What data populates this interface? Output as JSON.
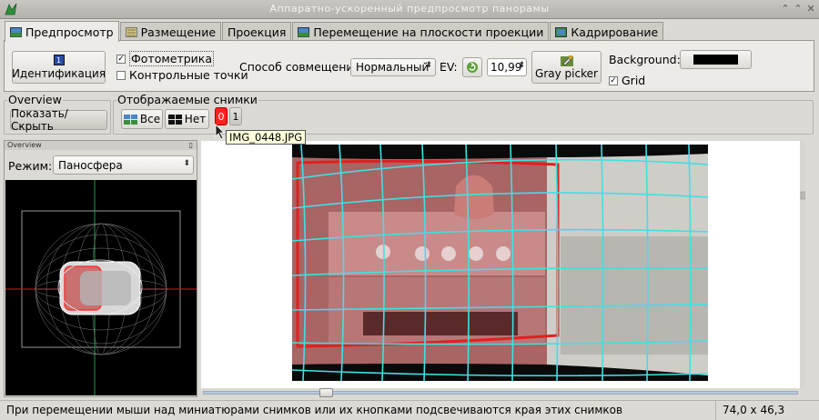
{
  "window": {
    "title": "Аппаратно-ускоренный предпросмотр панорамы",
    "buttons": [
      "⌃",
      "⌃",
      "✕"
    ]
  },
  "tabs": [
    {
      "label": "Предпросмотр",
      "active": true,
      "icon": "preview-icon"
    },
    {
      "label": "Размещение",
      "active": false,
      "icon": "layout-icon"
    },
    {
      "label": "Проекция",
      "active": false,
      "icon": ""
    },
    {
      "label": "Перемещение на плоскости проекции",
      "active": false,
      "icon": "move-icon"
    },
    {
      "label": "Кадрирование",
      "active": false,
      "icon": "crop-icon"
    }
  ],
  "toolbar": {
    "identify_label": "Идентификация",
    "identify_icon_text": "1",
    "photometry_label": "Фотометрика",
    "photometry_checked": true,
    "control_points_label": "Контрольные точки",
    "control_points_checked": false,
    "blend_label": "Способ совмещения:",
    "blend_value": "Нормальный",
    "ev_label": "EV:",
    "ev_value": "10,99",
    "gray_picker_label": "Gray picker",
    "background_label": "Background:",
    "background_color": "#000000",
    "grid_label": "Grid",
    "grid_checked": true
  },
  "overview_group": {
    "title": "Overview",
    "toggle_label": "Показать/Скрыть"
  },
  "images_group": {
    "title": "Отображаемые снимки",
    "all_label": "Все",
    "none_label": "Нет",
    "image_buttons": [
      "0",
      "1"
    ],
    "tooltip": "IMG_0448.JPG"
  },
  "overview_panel": {
    "header": "Overview",
    "mode_label": "Режим:",
    "mode_value": "Паносфера"
  },
  "status": {
    "message": "При перемещении мыши над миниатюрами снимков или их кнопками подсвечиваются края этих снимков",
    "fov": "74,0 x 46,3"
  },
  "colors": {
    "grid": "#3fe0e6",
    "highlight": "#e02020",
    "accent": "#ff2020"
  }
}
